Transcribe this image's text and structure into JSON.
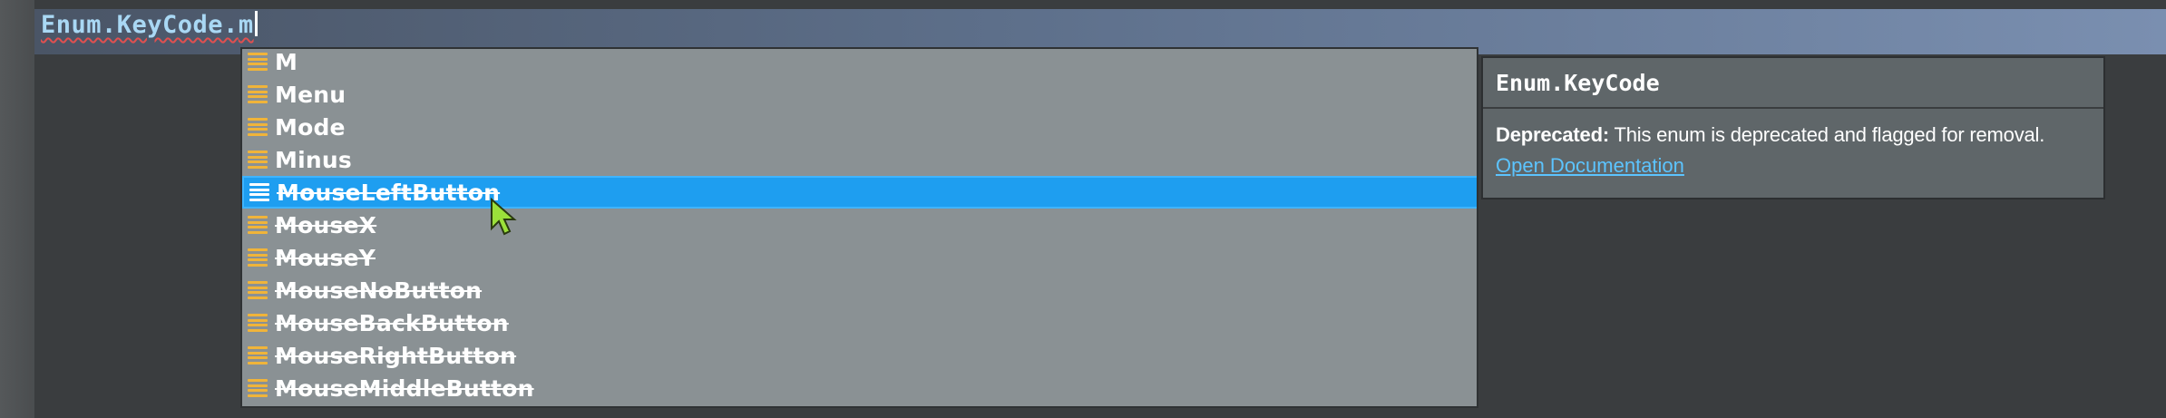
{
  "editor": {
    "code_prefix": "Enum.KeyCode.",
    "code_typed": "m"
  },
  "autocomplete": {
    "items": [
      {
        "label": "M",
        "deprecated": false,
        "selected": false
      },
      {
        "label": "Menu",
        "deprecated": false,
        "selected": false
      },
      {
        "label": "Mode",
        "deprecated": false,
        "selected": false
      },
      {
        "label": "Minus",
        "deprecated": false,
        "selected": false
      },
      {
        "label": "MouseLeftButton",
        "deprecated": true,
        "selected": true
      },
      {
        "label": "MouseX",
        "deprecated": true,
        "selected": false
      },
      {
        "label": "MouseY",
        "deprecated": true,
        "selected": false
      },
      {
        "label": "MouseNoButton",
        "deprecated": true,
        "selected": false
      },
      {
        "label": "MouseBackButton",
        "deprecated": true,
        "selected": false
      },
      {
        "label": "MouseRightButton",
        "deprecated": true,
        "selected": false
      },
      {
        "label": "MouseMiddleButton",
        "deprecated": true,
        "selected": false
      }
    ],
    "icon": "enum-item-icon"
  },
  "doc": {
    "title": "Enum.KeyCode",
    "deprecated_label": "Deprecated:",
    "deprecated_text": " This enum is deprecated and flagged for removal.",
    "link_label": "Open Documentation"
  },
  "colors": {
    "selection": "#1e9ef0",
    "icon": "#f0b43a",
    "link": "#5cc4ff",
    "code": "#a9d8f4"
  }
}
